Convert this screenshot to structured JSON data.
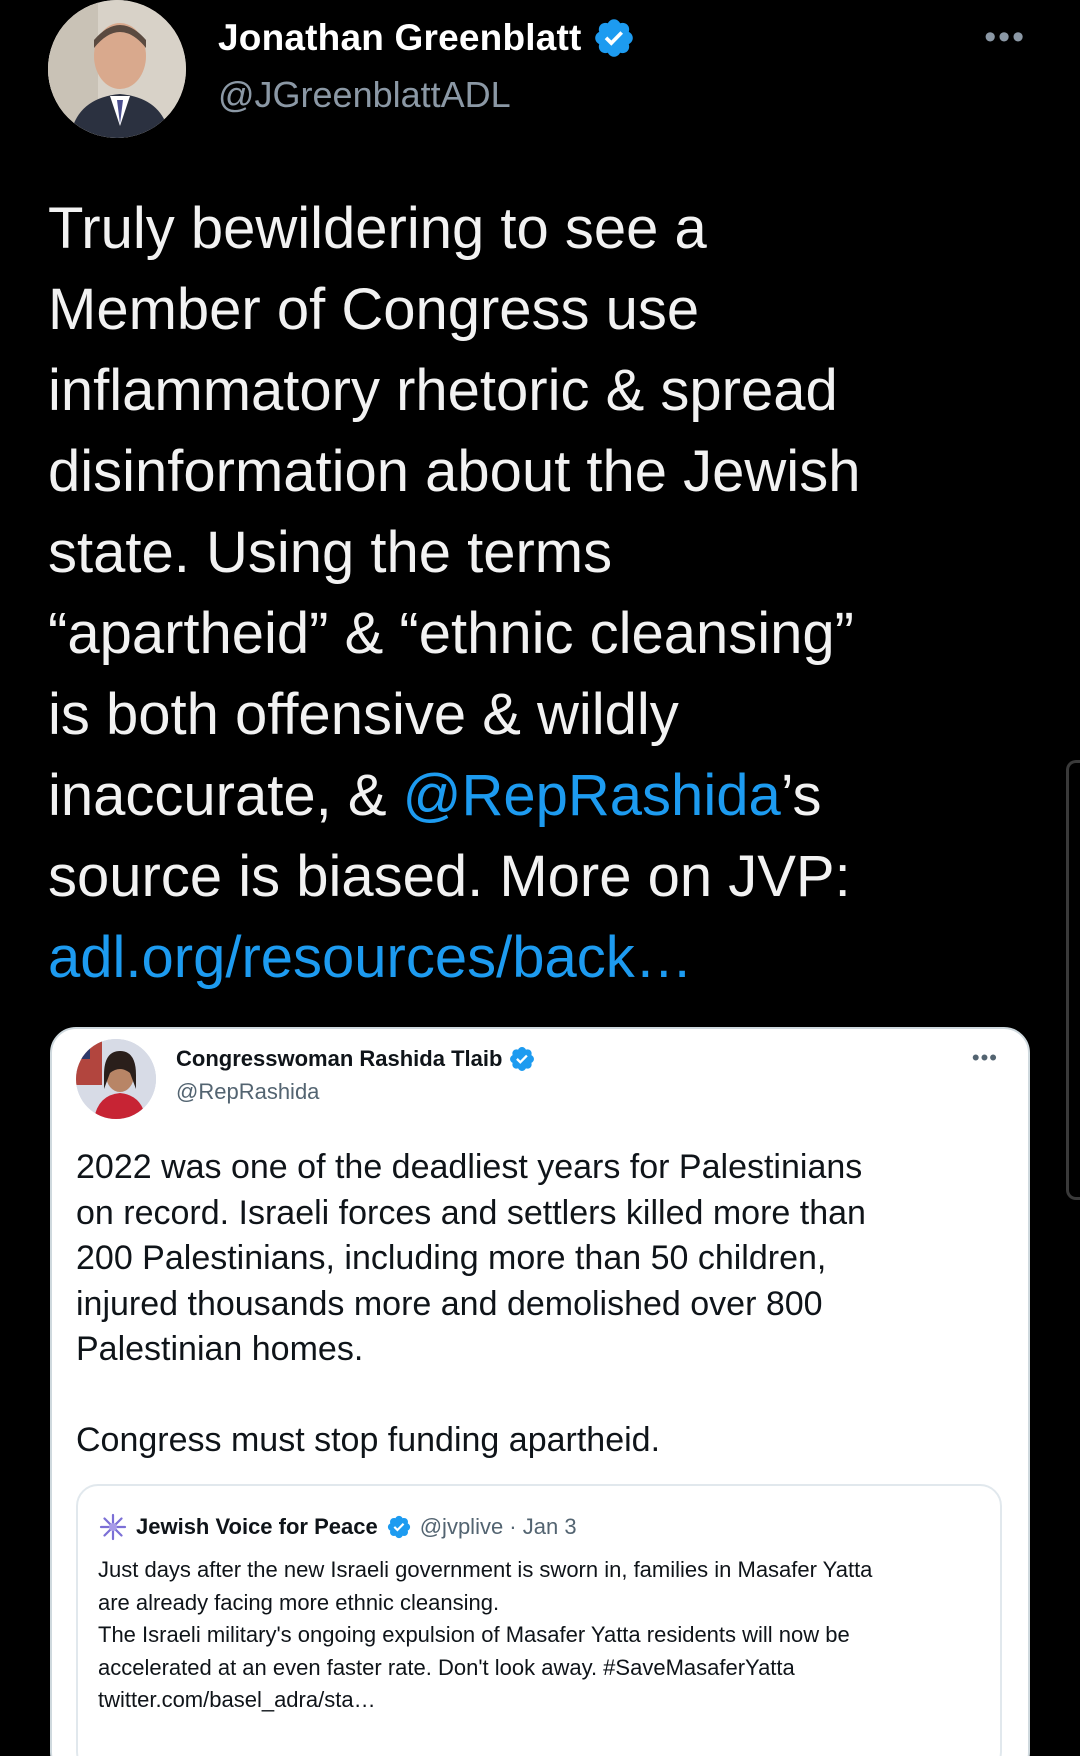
{
  "tweet": {
    "author_name": "Jonathan Greenblatt",
    "author_handle": "@JGreenblattADL",
    "more_icon": "more-icon",
    "text_part1": "Truly bewildering to see a\nMember of Congress use\ninflammatory rhetoric & spread\ndisinformation about the Jewish\nstate. Using the terms\n“apartheid” & “ethnic cleansing”\nis both offensive & wildly\ninaccurate, & ",
    "mention": "@RepRashida",
    "text_part2": "’s\nsource is biased. More on JVP:\n",
    "link": "adl.org/resources/back…"
  },
  "quoted": {
    "author_name": "Congresswoman Rashida Tlaib",
    "author_handle": "@RepRashida",
    "text": "2022 was one of the deadliest years for Palestinians\non record. Israeli forces and settlers killed more than\n200 Palestinians, including more than 50 children,\ninjured thousands more and demolished over 800\nPalestinian homes.\n\nCongress must stop funding apartheid.",
    "nested": {
      "author_name": "Jewish Voice for Peace",
      "meta": "@jvplive · Jan 3",
      "text": "Just days after the new Israeli government is sworn in, families in Masafer Yatta\nare already facing more ethnic cleansing.\nThe Israeli military's ongoing expulsion of Masafer Yatta residents will now be\naccelerated at an even faster rate. Don't look away. #SaveMasaferYatta\ntwitter.com/basel_adra/sta…"
    }
  },
  "colors": {
    "background": "#000000",
    "link_blue": "#1d9bf0",
    "verified_blue": "#1d9bf0",
    "secondary_text": "#8b98a5"
  }
}
